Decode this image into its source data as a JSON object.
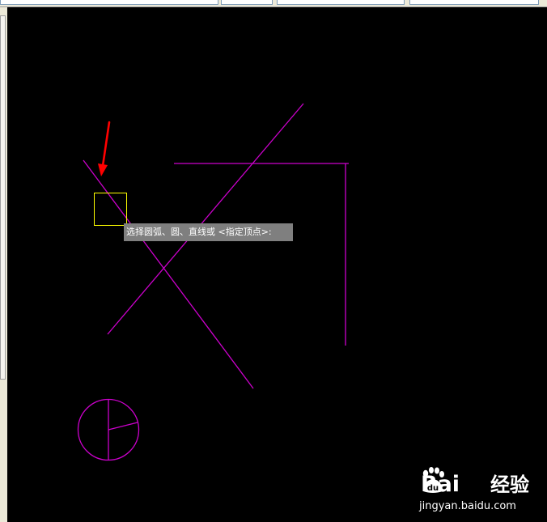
{
  "prompt": {
    "text": "选择圆弧、圆、直线或 <指定顶点>:"
  },
  "watermark": {
    "brand_left": "Bai",
    "brand_paw": "du",
    "brand_right": "经验",
    "url": "jingyan.baidu.com"
  },
  "colors": {
    "canvas_background": "#000000",
    "geometry": "#cc00cc",
    "pickbox": "#ffff00",
    "annotation_arrow": "#ff0000",
    "tooltip_background": "#7f7f7f"
  }
}
